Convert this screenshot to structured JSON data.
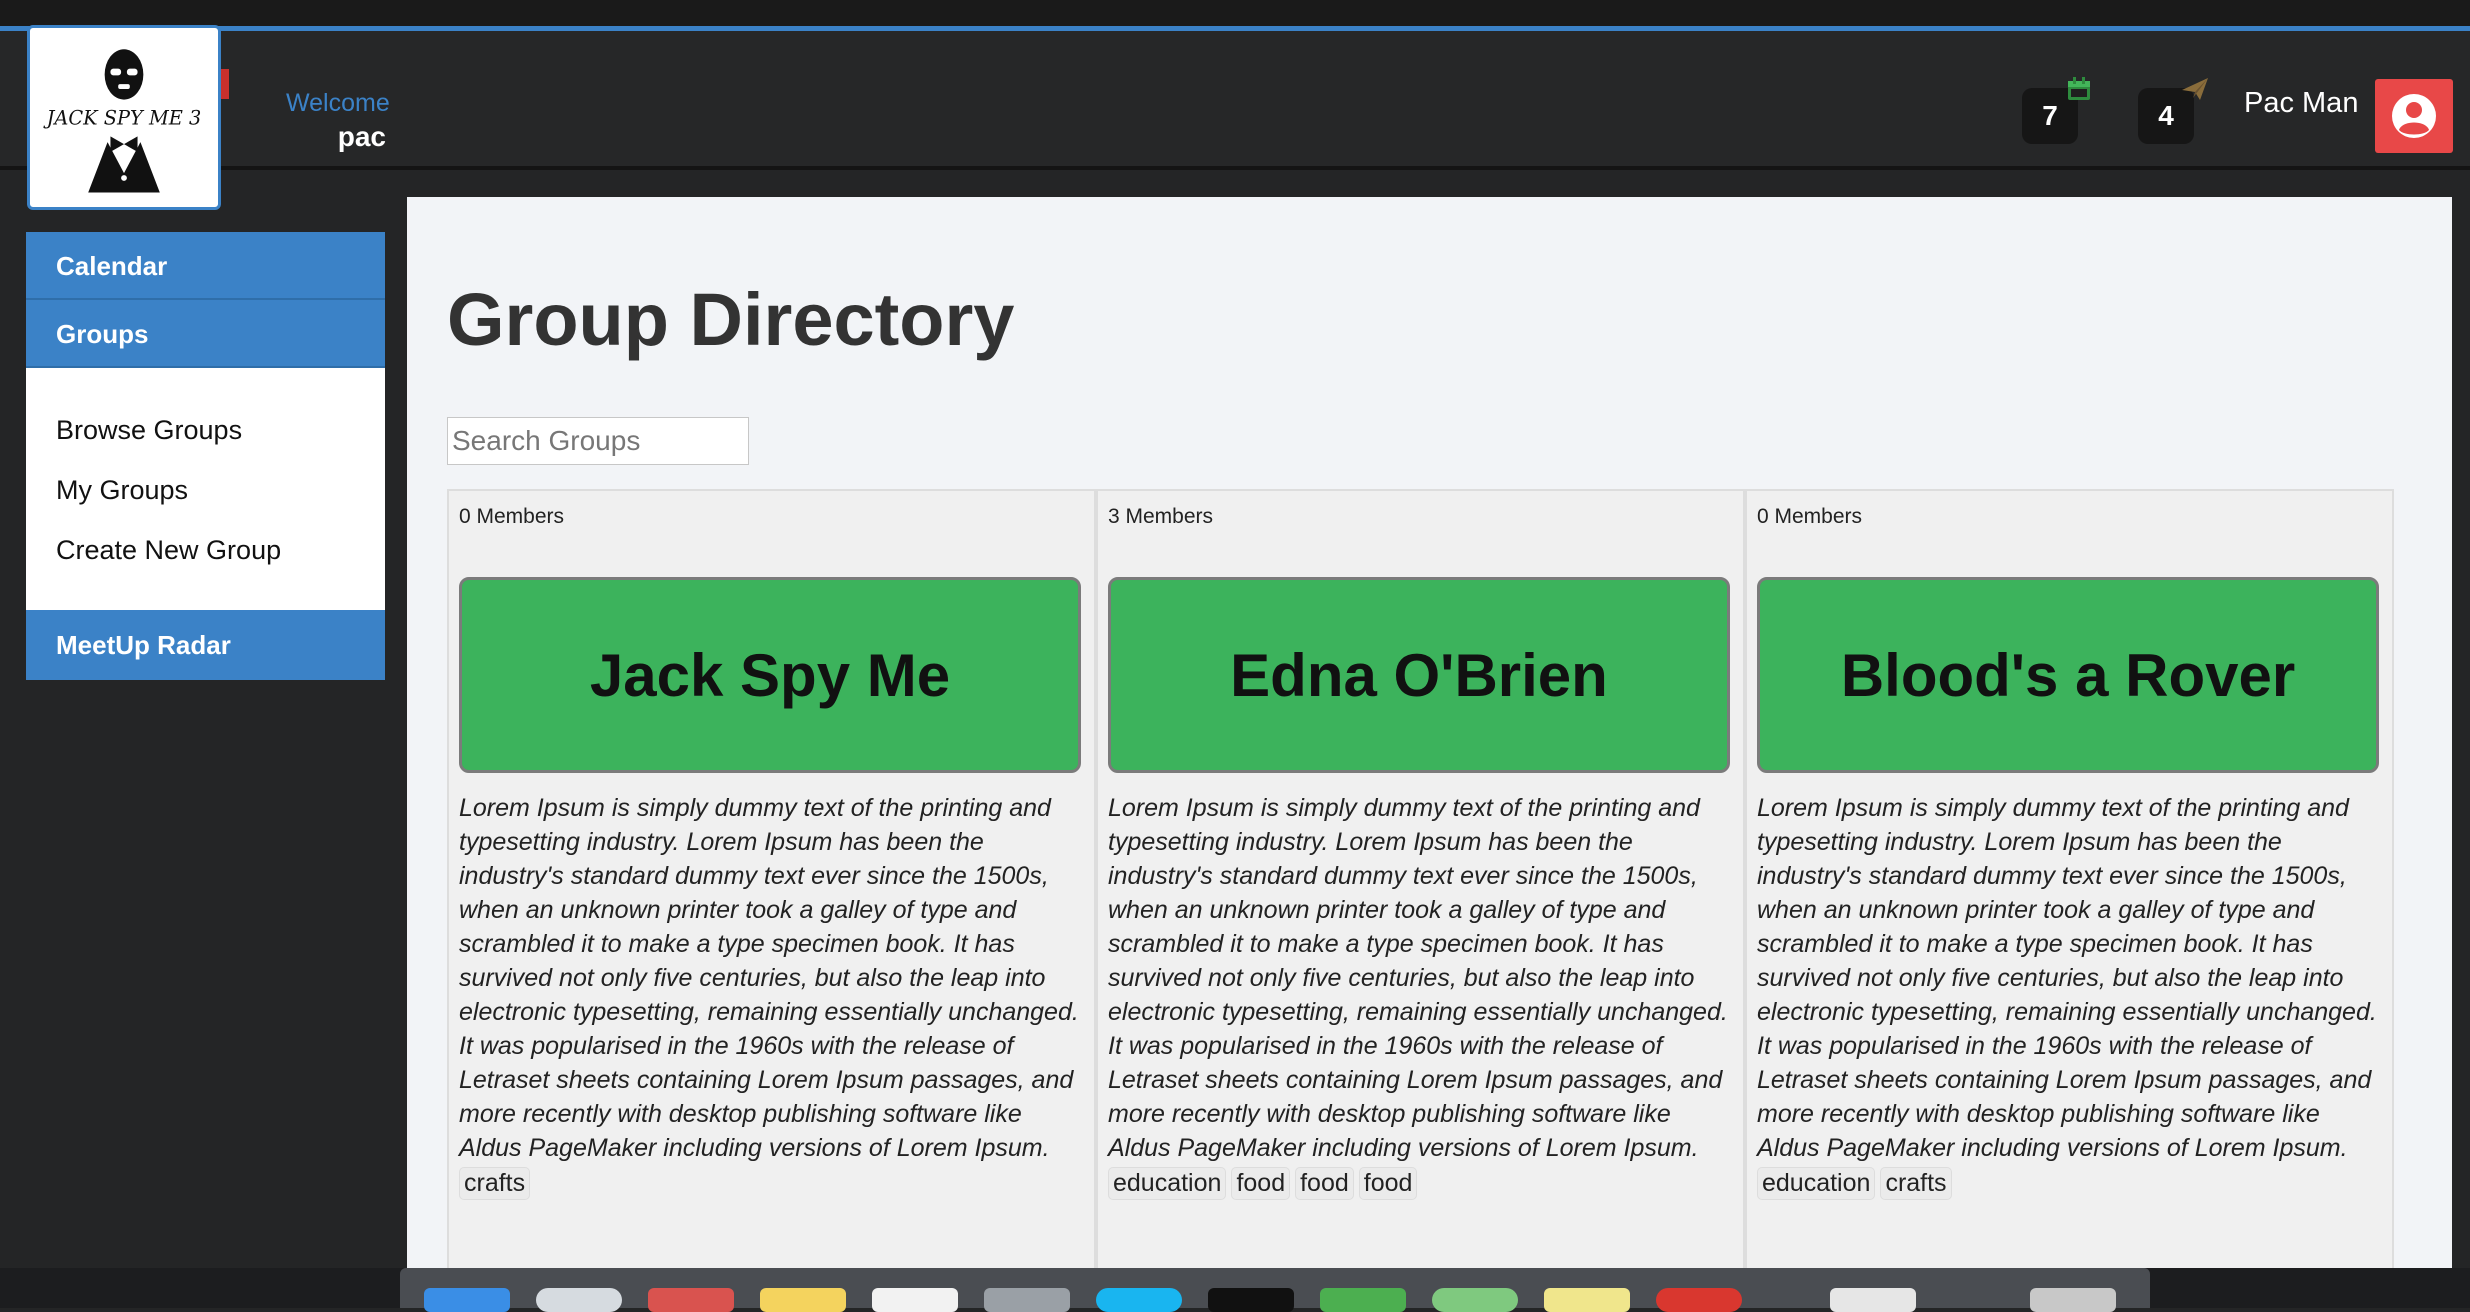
{
  "header": {
    "logo_text": "JACK SPY ME 3",
    "welcome_label": "Welcome",
    "welcome_user": "pac",
    "calendar_count": "7",
    "messages_count": "4",
    "user_name": "Pac Man",
    "icons": [
      "calendar-icon",
      "paper-plane-icon",
      "user-circle-icon"
    ]
  },
  "sidebar": {
    "calendar": "Calendar",
    "groups": "Groups",
    "group_items": [
      "Browse Groups",
      "My Groups",
      "Create New Group"
    ],
    "meetup_radar": "MeetUp Radar"
  },
  "main": {
    "title": "Group Directory",
    "search_placeholder": "Search Groups"
  },
  "groups": [
    {
      "members": "0 Members",
      "name": "Jack Spy Me",
      "description": "Lorem Ipsum is simply dummy text of the printing and typesetting industry. Lorem Ipsum has been the industry's standard dummy text ever since the 1500s, when an unknown printer took a galley of type and scrambled it to make a type specimen book. It has survived not only five centuries, but also the leap into electronic typesetting, remaining essentially unchanged. It was popularised in the 1960s with the release of Letraset sheets containing Lorem Ipsum passages, and more recently with desktop publishing software like Aldus PageMaker including versions of Lorem Ipsum.",
      "tags": [
        "crafts"
      ]
    },
    {
      "members": "3 Members",
      "name": "Edna O'Brien",
      "description": "Lorem Ipsum is simply dummy text of the printing and typesetting industry. Lorem Ipsum has been the industry's standard dummy text ever since the 1500s, when an unknown printer took a galley of type and scrambled it to make a type specimen book. It has survived not only five centuries, but also the leap into electronic typesetting, remaining essentially unchanged. It was popularised in the 1960s with the release of Letraset sheets containing Lorem Ipsum passages, and more recently with desktop publishing software like Aldus PageMaker including versions of Lorem Ipsum.",
      "tags": [
        "education",
        "food",
        "food",
        "food"
      ]
    },
    {
      "members": "0 Members",
      "name": "Blood's a Rover",
      "description": "Lorem Ipsum is simply dummy text of the printing and typesetting industry. Lorem Ipsum has been the industry's standard dummy text ever since the 1500s, when an unknown printer took a galley of type and scrambled it to make a type specimen book. It has survived not only five centuries, but also the leap into electronic typesetting, remaining essentially unchanged. It was popularised in the 1960s with the release of Letraset sheets containing Lorem Ipsum passages, and more recently with desktop publishing software like Aldus PageMaker including versions of Lorem Ipsum.",
      "tags": [
        "education",
        "crafts"
      ]
    }
  ],
  "colors": {
    "accent": "#3b82c7",
    "group_button": "#3cb35c",
    "avatar": "#e84848",
    "header_bg": "#262728"
  }
}
